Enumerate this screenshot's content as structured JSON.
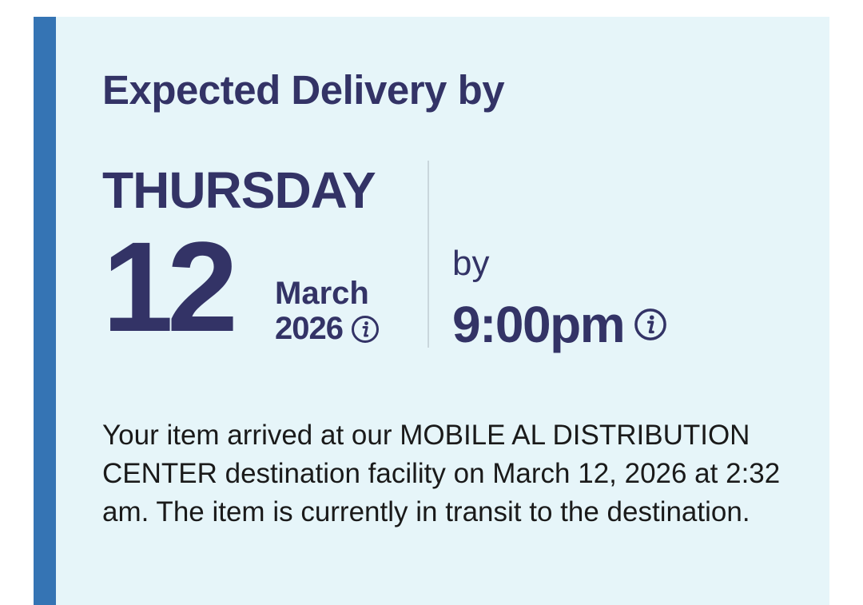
{
  "delivery": {
    "heading": "Expected Delivery by",
    "day_name": "THURSDAY",
    "day_number": "12",
    "month": "March",
    "year": "2026",
    "by_label": "by",
    "time": "9:00pm",
    "status_text": "Your item arrived at our MOBILE AL DISTRIBUTION CENTER destination facility on March 12, 2026 at 2:32 am. The item is currently in transit to the destination."
  },
  "icons": {
    "date_info": "info-icon",
    "time_info": "info-icon"
  },
  "colors": {
    "accent_bar": "#3574b4",
    "card_background": "#e6f5f9",
    "heading_text": "#333366",
    "body_text": "#1a1a1a"
  }
}
